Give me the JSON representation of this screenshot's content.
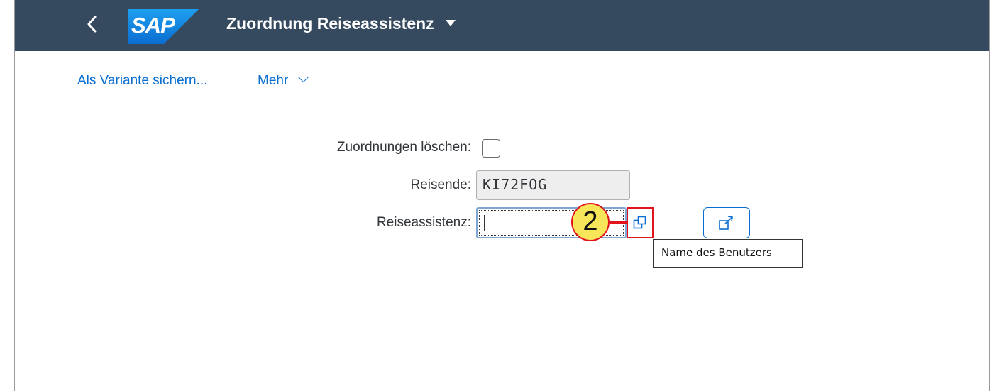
{
  "shell": {
    "title": "Zuordnung Reiseassistenz",
    "logo_text": "SAP",
    "background_color": "#354a5f",
    "logo_color": "#0a6ed1"
  },
  "toolbar": {
    "save_variant_label": "Als Variante sichern...",
    "more_label": "Mehr"
  },
  "form": {
    "delete_label": "Zuordnungen löschen:",
    "delete_checked": false,
    "traveler_label": "Reisende:",
    "traveler_value": "KI72FOG",
    "assistant_label": "Reiseassistenz:",
    "assistant_value": ""
  },
  "annotation": {
    "step_number": "2",
    "color": "#e2141b",
    "badge_color": "#f7e65a"
  },
  "tooltip": {
    "text": "Name des Benutzers"
  },
  "icons": {
    "back": "chevron-left-icon",
    "title_dropdown": "caret-down-icon",
    "more_dropdown": "chevron-down-icon",
    "value_help": "value-help-icon",
    "navigate": "navigation-icon"
  }
}
